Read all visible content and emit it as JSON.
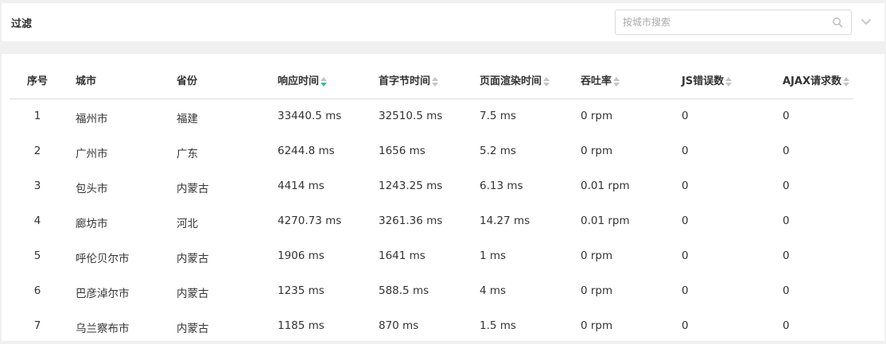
{
  "filter": {
    "title": "过滤",
    "search_placeholder": "按城市搜索"
  },
  "table": {
    "headers": [
      {
        "label": "序号",
        "sortable": false
      },
      {
        "label": "城市",
        "sortable": false
      },
      {
        "label": "省份",
        "sortable": false
      },
      {
        "label": "响应时间",
        "sortable": true,
        "sort": "desc"
      },
      {
        "label": "首字节时间",
        "sortable": true,
        "sort": "none"
      },
      {
        "label": "页面渲染时间",
        "sortable": true,
        "sort": "none"
      },
      {
        "label": "吞吐率",
        "sortable": true,
        "sort": "none"
      },
      {
        "label": "JS错误数",
        "sortable": true,
        "sort": "none"
      },
      {
        "label": "AJAX请求数",
        "sortable": true,
        "sort": "none"
      }
    ],
    "rows": [
      [
        "1",
        "福州市",
        "福建",
        "33440.5 ms",
        "32510.5 ms",
        "7.5 ms",
        "0 rpm",
        "0",
        "0"
      ],
      [
        "2",
        "广州市",
        "广东",
        "6244.8 ms",
        "1656 ms",
        "5.2 ms",
        "0 rpm",
        "0",
        "0"
      ],
      [
        "3",
        "包头市",
        "内蒙古",
        "4414 ms",
        "1243.25 ms",
        "6.13 ms",
        "0.01 rpm",
        "0",
        "0"
      ],
      [
        "4",
        "廊坊市",
        "河北",
        "4270.73 ms",
        "3261.36 ms",
        "14.27 ms",
        "0.01 rpm",
        "0",
        "0"
      ],
      [
        "5",
        "呼伦贝尔市",
        "内蒙古",
        "1906 ms",
        "1641 ms",
        "1 ms",
        "0 rpm",
        "0",
        "0"
      ],
      [
        "6",
        "巴彦淖尔市",
        "内蒙古",
        "1235 ms",
        "588.5 ms",
        "4 ms",
        "0 rpm",
        "0",
        "0"
      ],
      [
        "7",
        "乌兰察布市",
        "内蒙古",
        "1185 ms",
        "870 ms",
        "1.5 ms",
        "0 rpm",
        "0",
        "0"
      ]
    ]
  },
  "colors": {
    "sort_active": "#3cb8a2",
    "sort_inactive": "#c4c4c4",
    "background": "#f0f0f0",
    "panel": "#ffffff"
  }
}
